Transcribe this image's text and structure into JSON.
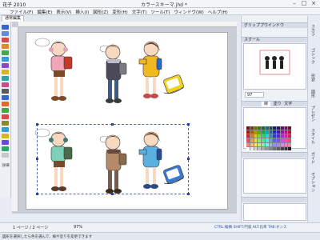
{
  "title_bar": {
    "app_name": "花子 2010",
    "document_title": "カラースキーマ.jhd *",
    "minimize": "–",
    "maximize": "□",
    "close": "×"
  },
  "menu": {
    "items": [
      "ファイル(F)",
      "編集(E)",
      "表示(V)",
      "挿入(I)",
      "図形(Z)",
      "変形(H)",
      "文字(T)",
      "ツール(T)",
      "ウィンドウ(W)",
      "ヘルプ(H)"
    ]
  },
  "tabs": {
    "active": "通常編集"
  },
  "toolbox": {
    "caption": "詳細"
  },
  "panels": {
    "group_window": "グリッププウインドウ",
    "scrapbook": "スクール",
    "page_number": "97",
    "color_tabs": [
      "線",
      "塗り",
      "文字"
    ],
    "detail_label": "詳細"
  },
  "right_tabs": [
    "スカラ",
    "ゴシック",
    "形状",
    "図形",
    "プレゼン",
    "スタイル",
    "ガイド",
    "オプション"
  ],
  "status": {
    "page_info": "1 ページ / 2 ページ",
    "zoom": "97%",
    "hint": "CTRL:縦横 SHIFT:円弧 ALT:比率 TAB:オンス"
  },
  "bottom": {
    "text": "図形を選択したら色を選んで、線や塗りを変更できます"
  },
  "colors": {
    "accent": "#2a3fb0",
    "panel_header": "#d6dde8",
    "canvas_bg": "#c9ced6"
  }
}
